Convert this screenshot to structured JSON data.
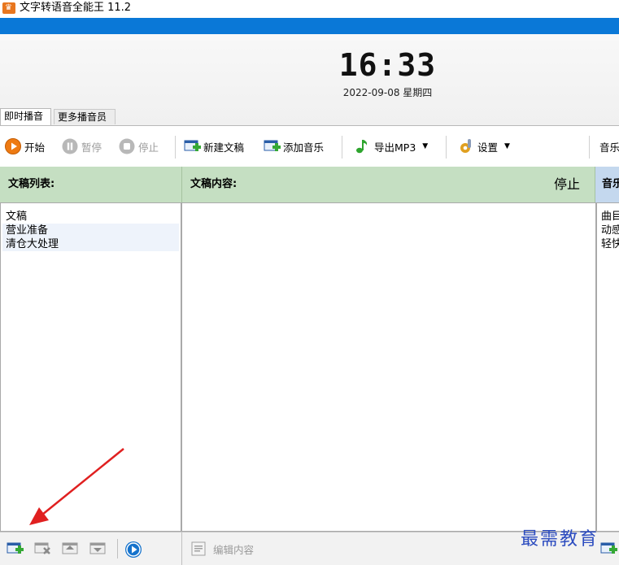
{
  "window": {
    "title": "文字转语音全能王 11.2"
  },
  "clock": {
    "time": "16:33",
    "date": "2022-09-08 星期四"
  },
  "tabs": [
    {
      "label": "即时播音"
    },
    {
      "label": "更多播音员"
    }
  ],
  "toolbar": {
    "start": "开始",
    "pause": "暂停",
    "stop": "停止",
    "new_doc": "新建文稿",
    "add_music": "添加音乐",
    "export_mp3": "导出MP3",
    "settings": "设置",
    "music_cut": "音乐"
  },
  "panels": {
    "doc_list_title": "文稿列表:",
    "doc_content_title": "文稿内容:",
    "status": "停止",
    "music_title_cut": "音乐",
    "doc_list": [
      "文稿",
      "营业准备",
      "清仓大处理"
    ],
    "music_list": [
      "曲目",
      "动感",
      "轻快"
    ]
  },
  "bottom": {
    "edit_content": "编辑内容"
  },
  "watermark": "最需教育",
  "colors": {
    "accent_blue": "#0a78d7",
    "panel_green": "#c5dfc2",
    "panel_blue": "#c4d8ee",
    "arrow_red": "#e02020"
  }
}
